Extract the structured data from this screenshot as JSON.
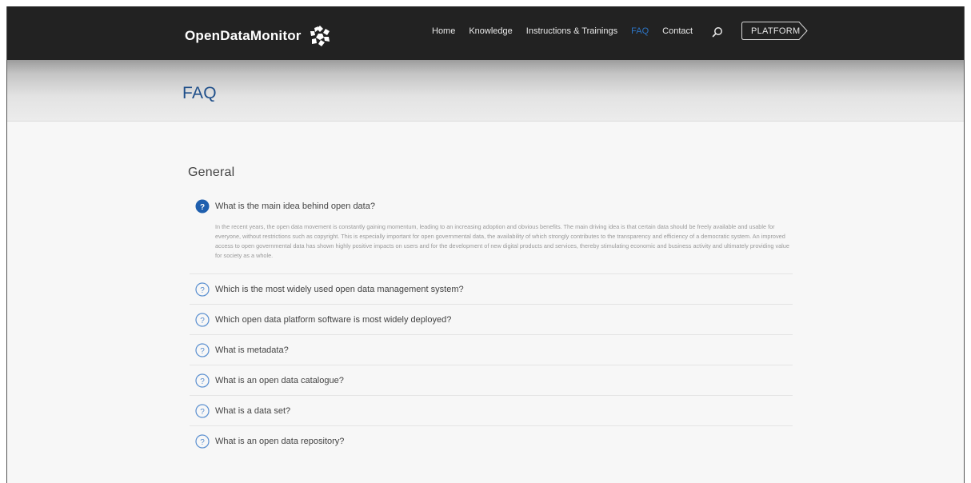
{
  "header": {
    "logo_text": "OpenDataMonitor",
    "nav": [
      {
        "label": "Home",
        "active": false
      },
      {
        "label": "Knowledge",
        "active": false
      },
      {
        "label": "Instructions & Trainings",
        "active": false
      },
      {
        "label": "FAQ",
        "active": true
      },
      {
        "label": "Contact",
        "active": false
      }
    ],
    "search_icon": "search-icon",
    "platform_label": "PLATFORM"
  },
  "hero": {
    "title": "FAQ"
  },
  "section": {
    "title": "General"
  },
  "faq": [
    {
      "question": "What is the main idea behind open data?",
      "expanded": true,
      "answer": "In the recent years, the open data movement is constantly gaining momentum, leading to an increasing adoption and obvious benefits. The main driving idea is that certain data should be freely available and usable for everyone, without restrictions such as copyright. This is especially important for open governmental data, the availability of which strongly contributes to the transparency and efficiency of a democratic system. An improved access to open governmental data has shown highly positive impacts on users and for the development of new digital products and services, thereby stimulating economic and business activity and ultimately providing value for society as a whole."
    },
    {
      "question": "Which is the most widely used open data management system?",
      "expanded": false
    },
    {
      "question": "Which open data platform software is most widely deployed?",
      "expanded": false
    },
    {
      "question": "What is metadata?",
      "expanded": false
    },
    {
      "question": "What is an open data catalogue?",
      "expanded": false
    },
    {
      "question": "What is a data set?",
      "expanded": false
    },
    {
      "question": "What is an open data repository?",
      "expanded": false
    }
  ],
  "colors": {
    "accent": "#2d74c4",
    "topbar": "#222222",
    "title": "#1f4f8a"
  }
}
